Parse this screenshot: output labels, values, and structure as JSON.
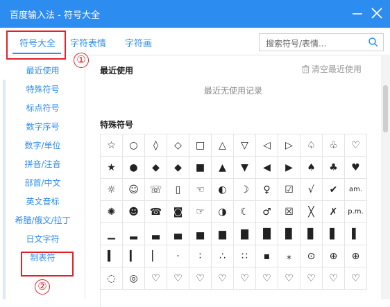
{
  "window": {
    "title": "百度输入法 - 符号大全"
  },
  "tabs": [
    {
      "label": "符号大全",
      "active": true
    },
    {
      "label": "字符表情",
      "active": false
    },
    {
      "label": "字符画",
      "active": false
    }
  ],
  "search": {
    "placeholder": "搜索符号/表情..."
  },
  "annotations": {
    "n1": "①",
    "n2": "②"
  },
  "sidebar": {
    "items": [
      {
        "label": "最近使用",
        "active": true
      },
      {
        "label": "特殊符号"
      },
      {
        "label": "标点符号"
      },
      {
        "label": "数字序号"
      },
      {
        "label": "数字/单位"
      },
      {
        "label": "拼音/注音"
      },
      {
        "label": "部首/中文"
      },
      {
        "label": "英文音标"
      },
      {
        "label": "希腊/俄文/拉丁"
      },
      {
        "label": "日文字符"
      },
      {
        "label": "制表符"
      }
    ]
  },
  "main": {
    "recent_title": "最近使用",
    "clear_label": "清空最近使用",
    "empty_text": "最近无使用记录",
    "special_title": "特殊符号"
  },
  "symbols": [
    [
      "☆",
      "○",
      "◊",
      "◇",
      "□",
      "△",
      "▽",
      "◁",
      "▷",
      "♤",
      "♧",
      "♡"
    ],
    [
      "★",
      "●",
      "◆",
      "◆",
      "■",
      "▲",
      "▼",
      "◀",
      "▶",
      "♠",
      "♣",
      "♥"
    ],
    [
      "☼",
      "☺",
      "☏",
      "▯",
      "☜",
      "◐",
      "☽",
      "♀",
      "☑",
      "√",
      "✔",
      "am."
    ],
    [
      "✺",
      "☻",
      "☎",
      "◙",
      "☞",
      "◑",
      "☾",
      "♂",
      "☒",
      "╳",
      "✗",
      "p.m."
    ],
    [
      "▁",
      "▂",
      "▃",
      "▄",
      "▅",
      "▆",
      "▇",
      "█",
      "▉",
      "▊",
      "▋",
      "▌"
    ],
    [
      "▍",
      "▎",
      "▏",
      "·",
      "∶",
      "∴",
      "∷",
      "▪",
      "⁎",
      "⊙",
      "⊕",
      "⊕"
    ],
    [
      "◌",
      "◎",
      "♡",
      "♡",
      "♡",
      "♡",
      "♡",
      "♡",
      "♡",
      "♡",
      "♡",
      "♡"
    ]
  ],
  "colors": {
    "accent": "#2d8cf0",
    "annotation": "#e0212b"
  }
}
